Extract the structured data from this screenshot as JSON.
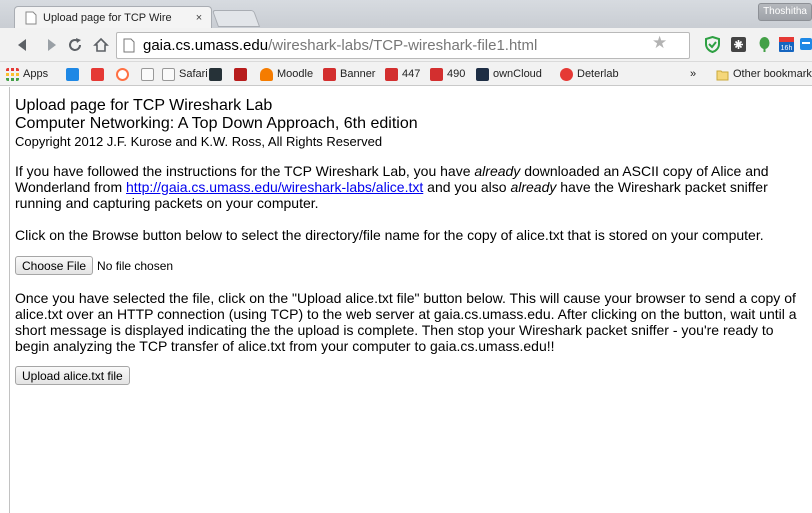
{
  "browser": {
    "tab_title": "Upload page for TCP Wire",
    "tab_close": "×",
    "profile_label": "Thoshitha",
    "url_host": "gaia.cs.umass.edu",
    "url_path": "/wireshark-labs/TCP-wireshark-file1.html",
    "nav_icons": [
      "back-arrow-icon",
      "forward-arrow-icon",
      "reload-icon",
      "home-icon"
    ],
    "extensions": [
      {
        "name": "shield-extension-icon",
        "color": "#2ea043"
      },
      {
        "name": "puzzle-extension-icon",
        "color": "#444444"
      },
      {
        "name": "evernote-extension-icon",
        "color": "#43a047"
      },
      {
        "name": "calendar-extension-icon",
        "color": "#1565c0",
        "badge": "16h"
      },
      {
        "name": "pocket-extension-icon",
        "color": "#1e88e5"
      }
    ],
    "menu_glyph": "≡",
    "bookmarks": [
      {
        "label": "Apps",
        "icon": "apps-grid-icon",
        "color": "#e53935"
      },
      {
        "label": "",
        "icon": "generic-blue-icon",
        "color": "#1e88e5"
      },
      {
        "label": "",
        "icon": "generic-red-icon",
        "color": "#e53935"
      },
      {
        "label": "",
        "icon": "generic-red-c-icon",
        "color": "#ff7043"
      },
      {
        "label": "",
        "icon": "blank-page-icon",
        "color": "#dddddd"
      },
      {
        "label": "Safari",
        "icon": "page-icon",
        "color": "#dddddd"
      },
      {
        "label": "",
        "icon": "cs-icon",
        "color": "#263238"
      },
      {
        "label": "",
        "icon": "red-square-icon",
        "color": "#b71c1c"
      },
      {
        "label": "Moodle",
        "icon": "moodle-icon",
        "color": "#f57c00"
      },
      {
        "label": "Banner",
        "icon": "banner-icon",
        "color": "#d32f2f"
      },
      {
        "label": "447",
        "icon": "red-c-icon",
        "color": "#d32f2f"
      },
      {
        "label": "490",
        "icon": "red-c-icon",
        "color": "#d32f2f"
      },
      {
        "label": "ownCloud",
        "icon": "owncloud-icon",
        "color": "#1d2d44"
      },
      {
        "label": "Deterlab",
        "icon": "deterlab-icon",
        "color": "#e53935"
      }
    ],
    "overflow": "»",
    "other_bookmarks": "Other bookmarks"
  },
  "page": {
    "title": "Upload page for TCP Wireshark Lab",
    "subtitle": "Computer Networking: A Top Down Approach, 6th edition",
    "copyright": "Copyright 2012 J.F. Kurose and K.W. Ross, All Rights Reserved",
    "intro_1": "If you have followed the instructions for the TCP Wireshark Lab, you have ",
    "intro_em1": "already",
    "intro_2": " downloaded an ASCII copy of Alice and Wonderland from ",
    "intro_link": "http://gaia.cs.umass.edu/wireshark-labs/alice.txt",
    "intro_3": " and you also ",
    "intro_em2": "already",
    "intro_4": " have the Wireshark packet sniffer running and capturing packets on your computer.",
    "browse_instruction": "Click on the Browse button below to select the directory/file name for the copy of alice.txt that is stored on your computer.",
    "choose_file_label": "Choose File",
    "no_file_text": "No file chosen",
    "upload_instruction": "Once you have selected the file, click on the \"Upload alice.txt file\" button below. This will cause your browser to send a copy of alice.txt over an HTTP connection (using TCP) to the web server at gaia.cs.umass.edu. After clicking on the button, wait until a short message is displayed indicating the the upload is complete. Then stop your Wireshark packet sniffer - you're ready to begin analyzing the TCP transfer of alice.txt from your computer to gaia.cs.umass.edu!!",
    "upload_button_label": "Upload alice.txt file"
  }
}
